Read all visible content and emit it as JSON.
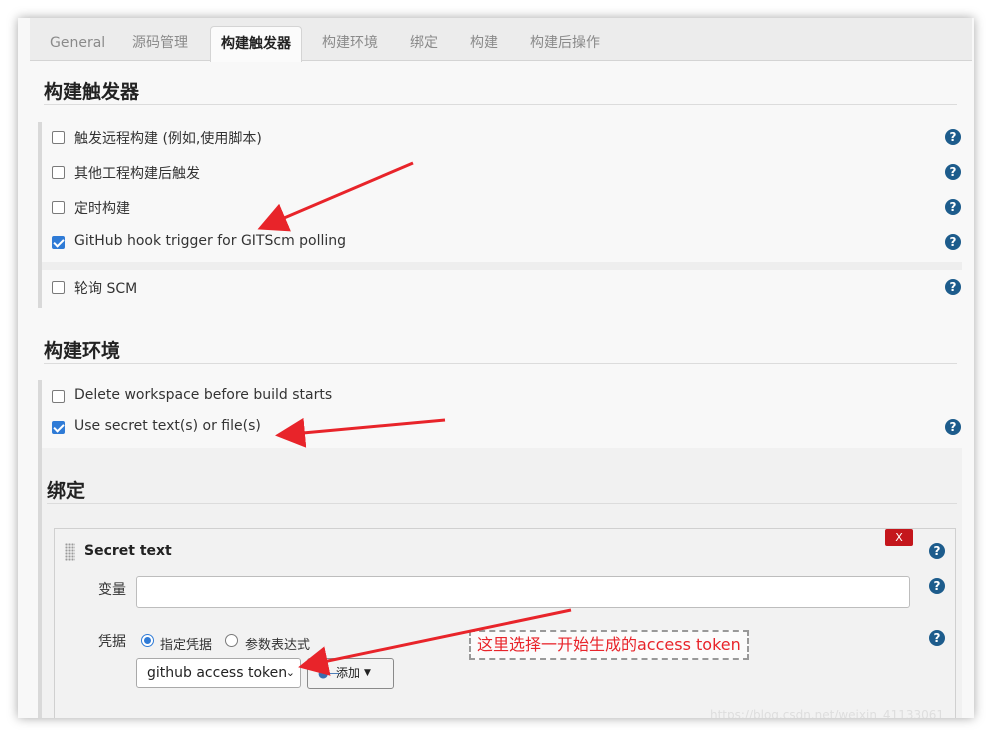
{
  "tabs": [
    "General",
    "源码管理",
    "构建触发器",
    "构建环境",
    "绑定",
    "构建",
    "构建后操作"
  ],
  "active_tab": "构建触发器",
  "triggers": {
    "title": "构建触发器",
    "items": [
      {
        "label": "触发远程构建 (例如,使用脚本)",
        "checked": false
      },
      {
        "label": "其他工程构建后触发",
        "checked": false
      },
      {
        "label": "定时构建",
        "checked": false
      },
      {
        "label": "GitHub hook trigger for GITScm polling",
        "checked": true
      },
      {
        "label": "轮询 SCM",
        "checked": false
      }
    ]
  },
  "build_env": {
    "title": "构建环境",
    "items": [
      {
        "label": "Delete workspace before build starts",
        "checked": false
      },
      {
        "label": "Use secret text(s) or file(s)",
        "checked": true
      }
    ]
  },
  "bindings": {
    "title": "绑定",
    "panel_title": "Secret text",
    "delete_label": "X",
    "variable_label": "变量",
    "variable_value": "",
    "credentials_label": "凭据",
    "radio_specific": "指定凭据",
    "radio_param": "参数表达式",
    "selected_credential": "github access token",
    "add_button": "添加"
  },
  "help_glyph": "?",
  "annotation": "这里选择一开始生成的access token",
  "watermark": "https://blog.csdn.net/weixin_41133061",
  "colors": {
    "accent": "#2f7bd6",
    "help": "#1d5c8c",
    "danger": "#c4161c",
    "annotation": "#e8242a"
  },
  "icons": [
    "help-icon",
    "key-icon",
    "drag-handle-icon",
    "caret-down-icon"
  ]
}
